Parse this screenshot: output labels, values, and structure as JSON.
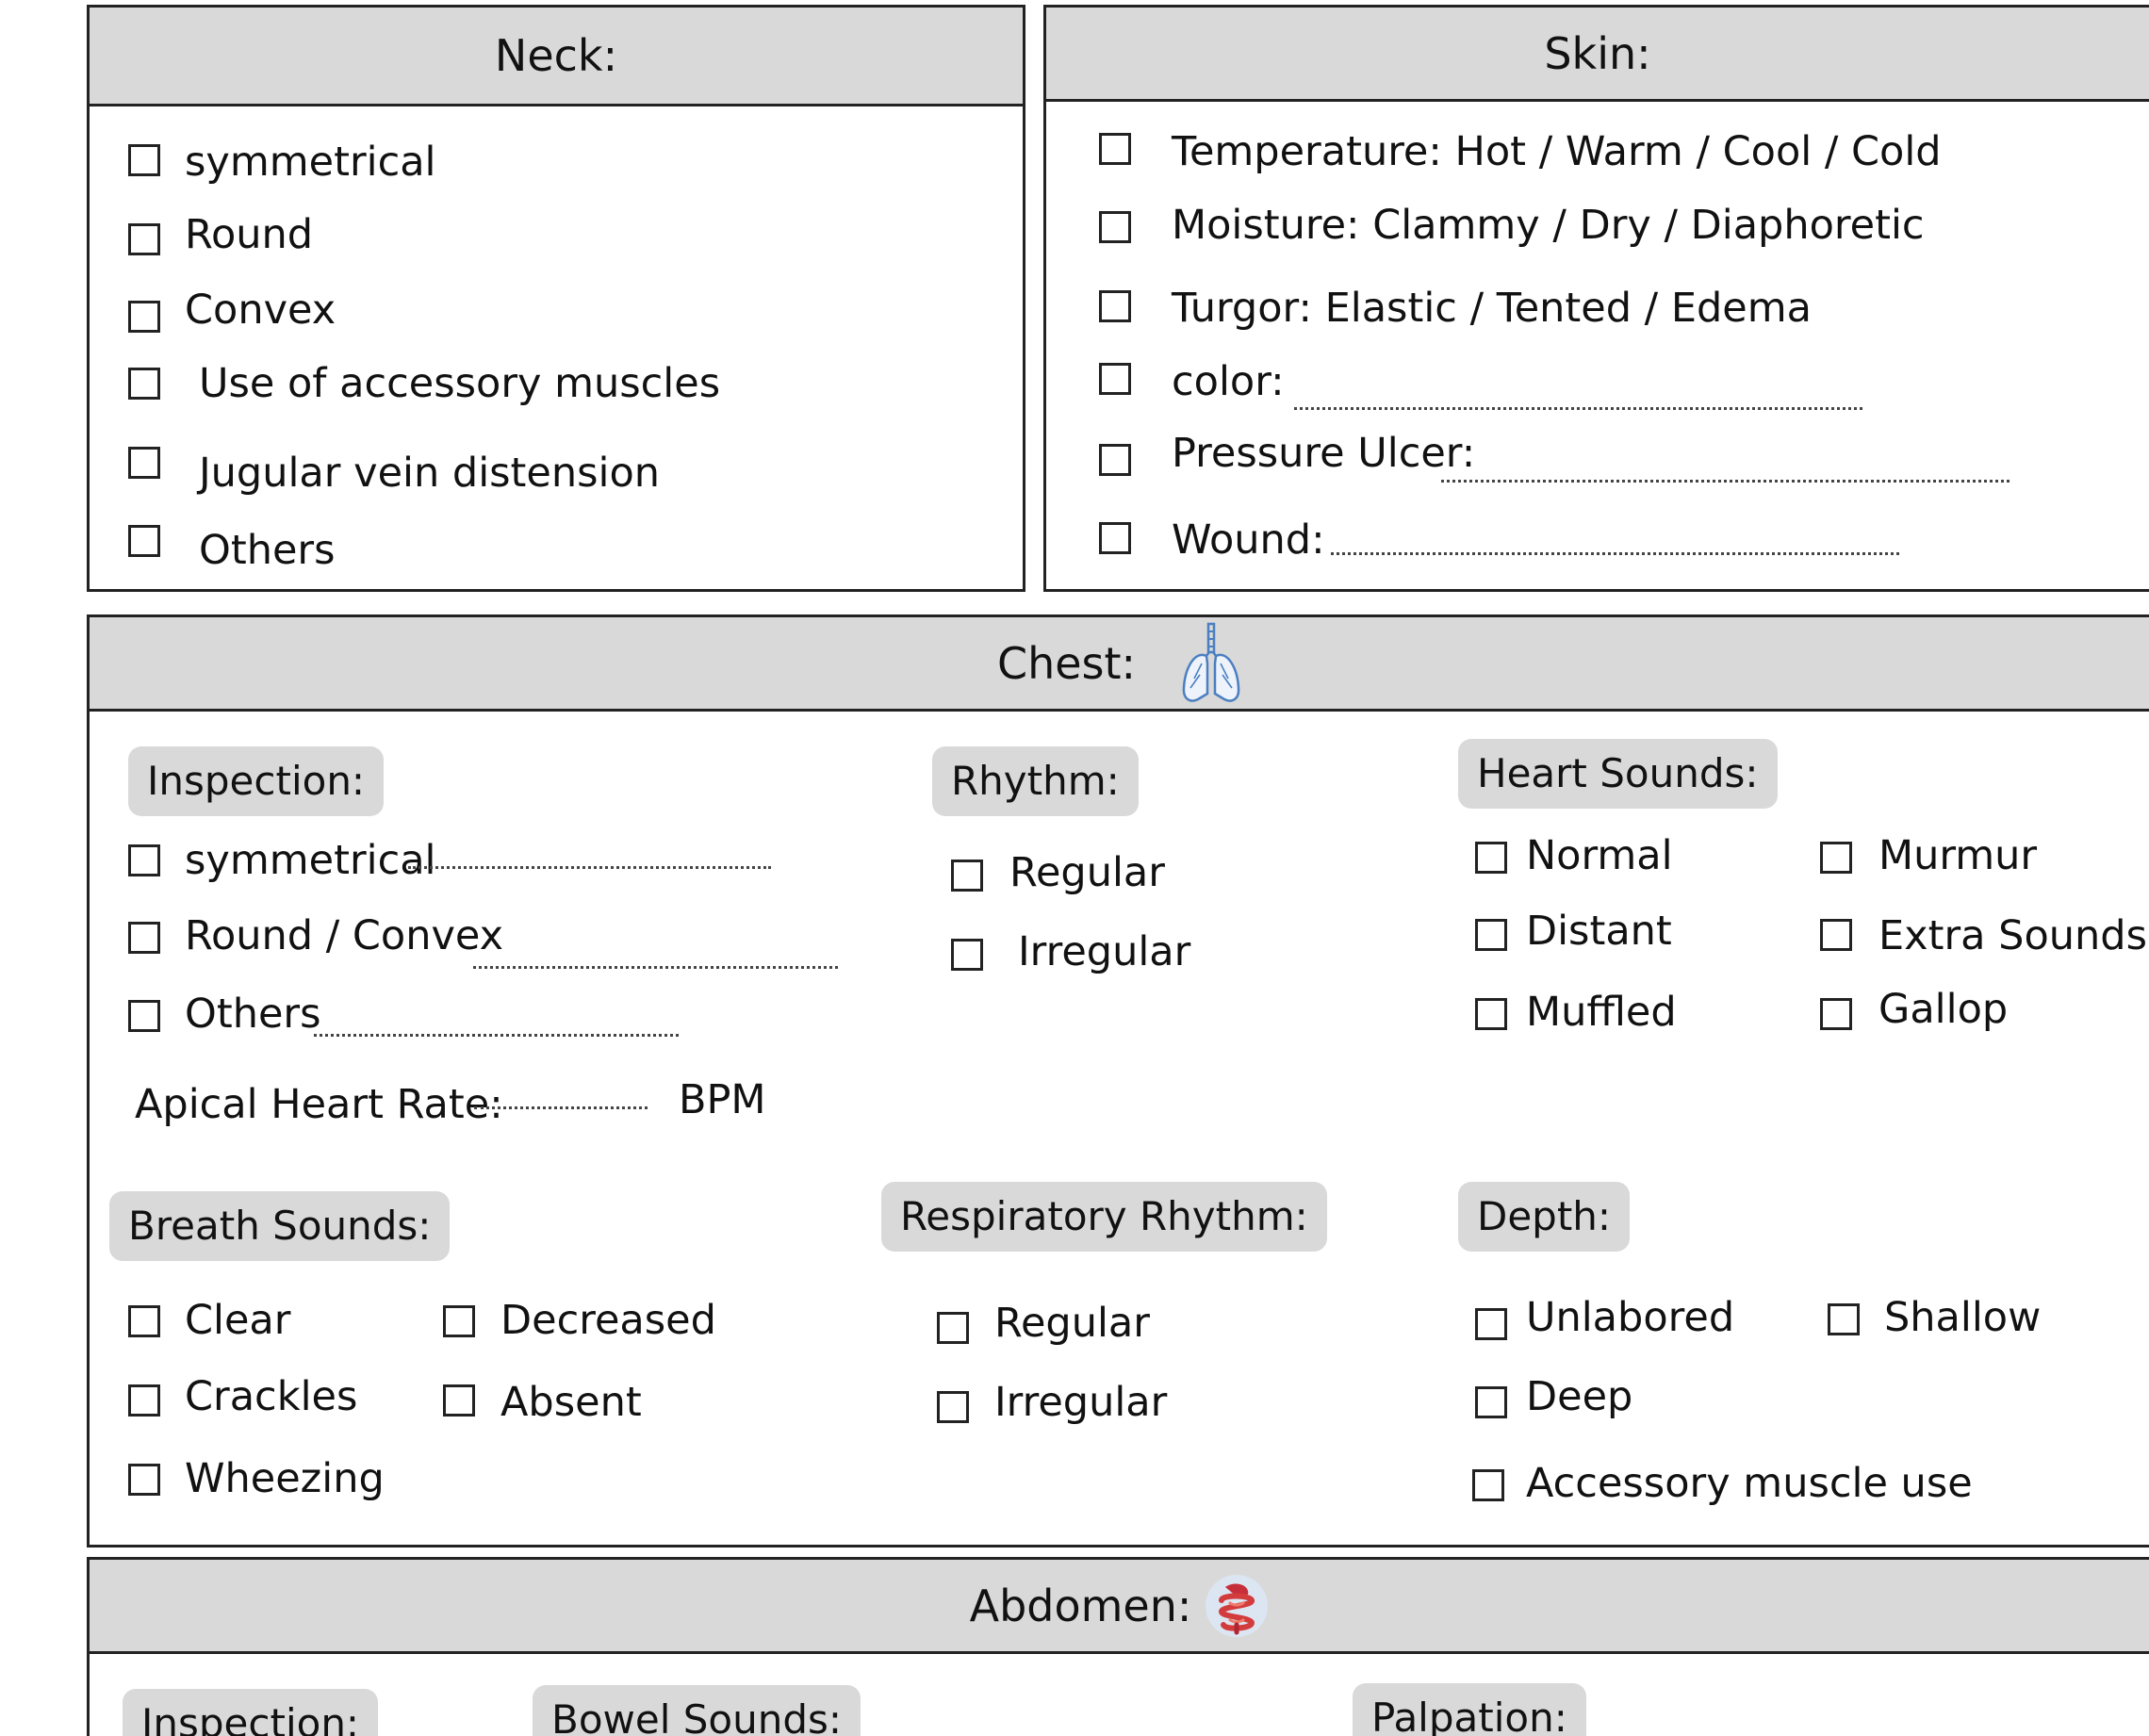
{
  "neck": {
    "title": "Neck:",
    "items": [
      "symmetrical",
      "Round",
      "Convex",
      "Use of accessory muscles",
      "Jugular vein distension",
      "Others"
    ]
  },
  "skin": {
    "title": "Skin:",
    "items": [
      "Temperature: Hot / Warm / Cool / Cold",
      "Moisture: Clammy / Dry / Diaphoretic",
      "Turgor: Elastic / Tented / Edema",
      "color:",
      "Pressure Ulcer:",
      "Wound:"
    ]
  },
  "chest": {
    "title": "Chest:",
    "inspection": {
      "heading": "Inspection:",
      "items": [
        "symmetrical",
        "Round / Convex",
        "Others"
      ],
      "apical_label": "Apical Heart Rate:",
      "apical_unit": "BPM"
    },
    "rhythm": {
      "heading": "Rhythm:",
      "items": [
        "Regular",
        "Irregular"
      ]
    },
    "heart_sounds": {
      "heading": "Heart Sounds:",
      "items": [
        "Normal",
        "Distant",
        "Muffled",
        "Murmur",
        "Extra Sounds",
        "Gallop"
      ]
    },
    "breath_sounds": {
      "heading": "Breath Sounds:",
      "items": [
        "Clear",
        "Crackles",
        "Wheezing",
        "Decreased",
        "Absent"
      ]
    },
    "respiratory_rhythm": {
      "heading": "Respiratory Rhythm:",
      "items": [
        "Regular",
        "Irregular"
      ]
    },
    "depth": {
      "heading": "Depth:",
      "items": [
        "Unlabored",
        "Deep",
        "Accessory muscle use",
        "Shallow"
      ]
    }
  },
  "abdomen": {
    "title": "Abdomen:",
    "headings": [
      "Inspection:",
      "Bowel Sounds:",
      "Palpation:"
    ]
  },
  "icons": {
    "chest": "lungs-icon",
    "abdomen": "intestines-icon"
  },
  "colors": {
    "header_bg": "#d9d9d9",
    "border": "#222222",
    "lungs": "#4a7fc1",
    "intestines": "#d33c3c"
  }
}
